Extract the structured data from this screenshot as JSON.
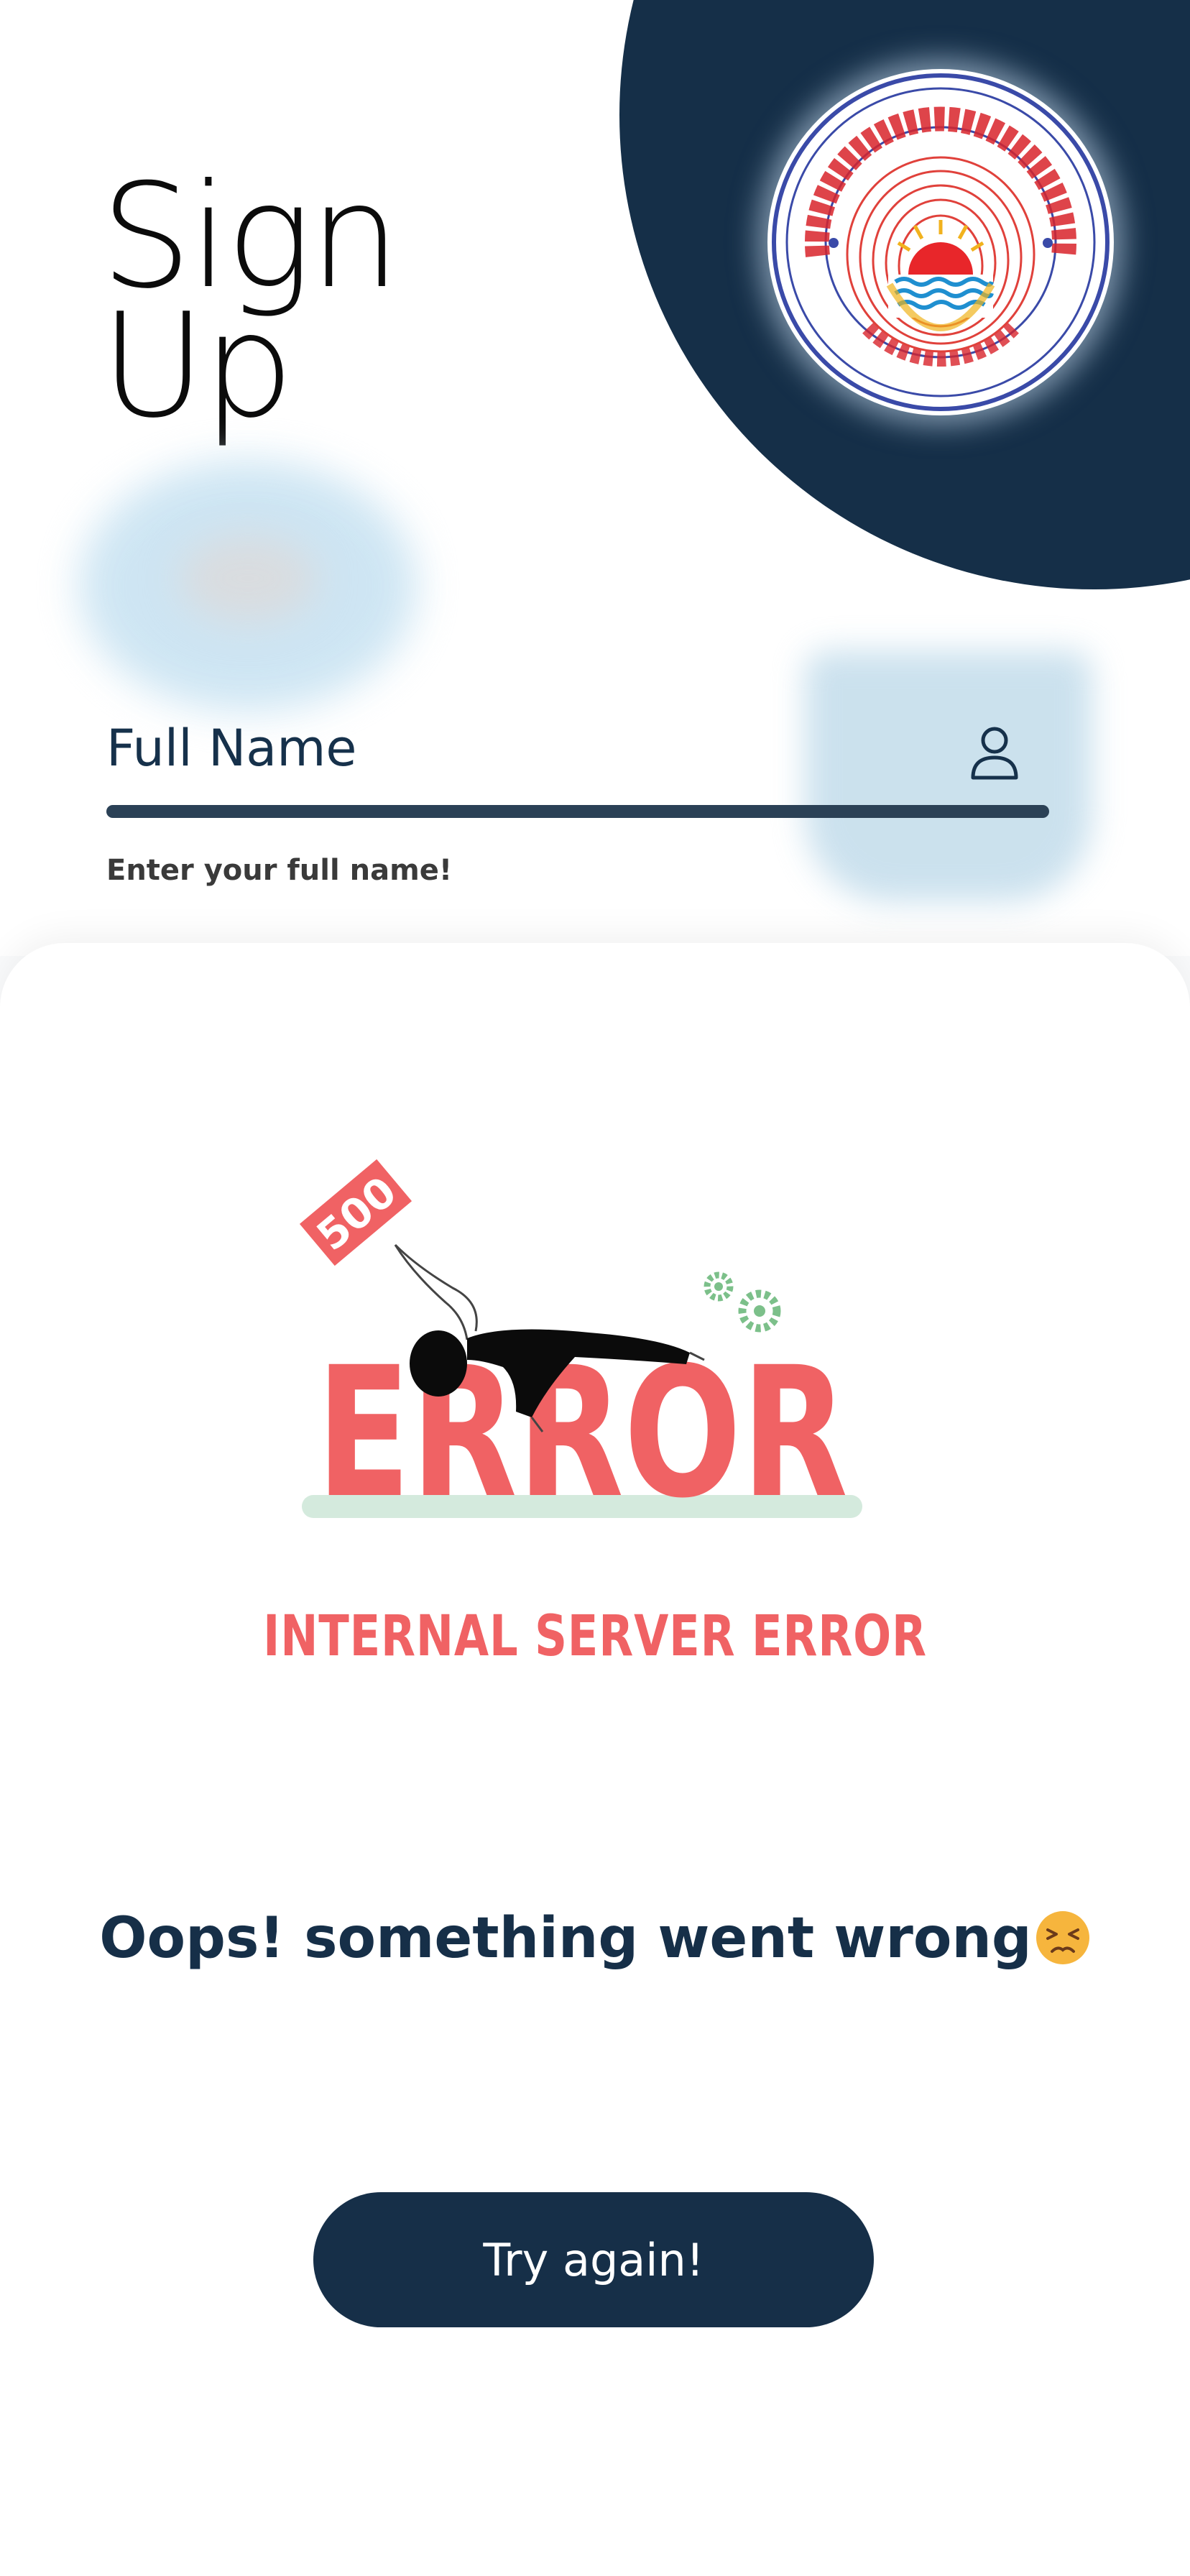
{
  "signup": {
    "title_line1": "Sign",
    "title_line2": "Up",
    "full_name_label": "Full Name",
    "full_name_error": "Enter your full name!",
    "logo_icon": "university-emblem",
    "user_icon": "user-icon"
  },
  "error_sheet": {
    "illustration": {
      "sign_number": "500",
      "big_word": "ERROR"
    },
    "caption": "INTERNAL SERVER ERROR",
    "message": "Oops! something went wrong",
    "emoji_icon": "persevering-face-emoji",
    "button_label": "Try again!"
  },
  "colors": {
    "navy": "#162f48",
    "error_red": "#f06264",
    "gear_green": "#7cc08a",
    "logo_red": "#d8232a"
  }
}
